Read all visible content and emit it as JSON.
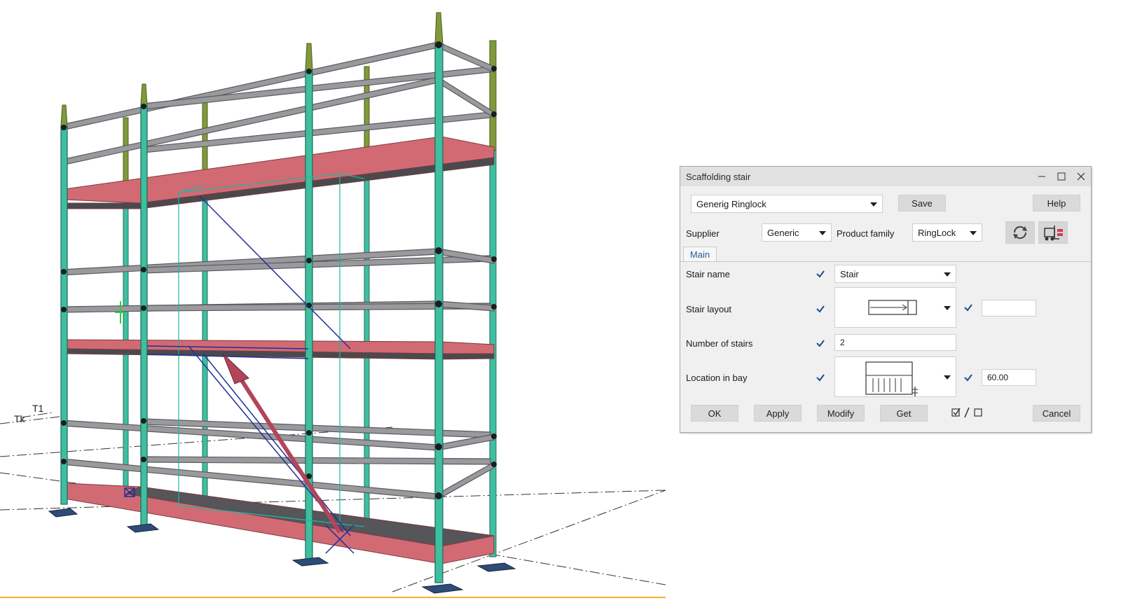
{
  "viewport": {
    "grid_labels": [
      "T1",
      "Tk"
    ],
    "colors": {
      "standard": "#3dbfa0",
      "top_standard": "#7f9a3a",
      "ledger": "#8f8f93",
      "deck": "#d26a74",
      "base_plate": "#2f4b78",
      "stair_outline": "#1f2f9a",
      "arrow": "#b2455a"
    }
  },
  "dialog": {
    "title": "Scaffolding stair",
    "window_icons": [
      "minimize-icon",
      "maximize-icon",
      "close-icon"
    ],
    "preset": "Generig Ringlock",
    "save_label": "Save",
    "help_label": "Help",
    "supplier_label": "Supplier",
    "supplier_value": "Generic",
    "product_family_label": "Product family",
    "product_family_value": "RingLock",
    "tab_main": "Main",
    "rows": {
      "stair_name": {
        "label": "Stair name",
        "value": "Stair",
        "checked": true
      },
      "stair_layout": {
        "label": "Stair layout",
        "checked": true,
        "extra_checked": true,
        "extra_value": ""
      },
      "number_of_stairs": {
        "label": "Number of stairs",
        "value": "2",
        "checked": true
      },
      "location_in_bay": {
        "label": "Location in bay",
        "checked": true,
        "extra_checked": true,
        "extra_value": "60.00"
      }
    },
    "buttons": {
      "ok": "OK",
      "apply": "Apply",
      "modify": "Modify",
      "get": "Get",
      "cancel": "Cancel"
    },
    "colors": {
      "background": "#f0f0f0",
      "button": "#dadada",
      "check": "#1f4e8c"
    }
  }
}
